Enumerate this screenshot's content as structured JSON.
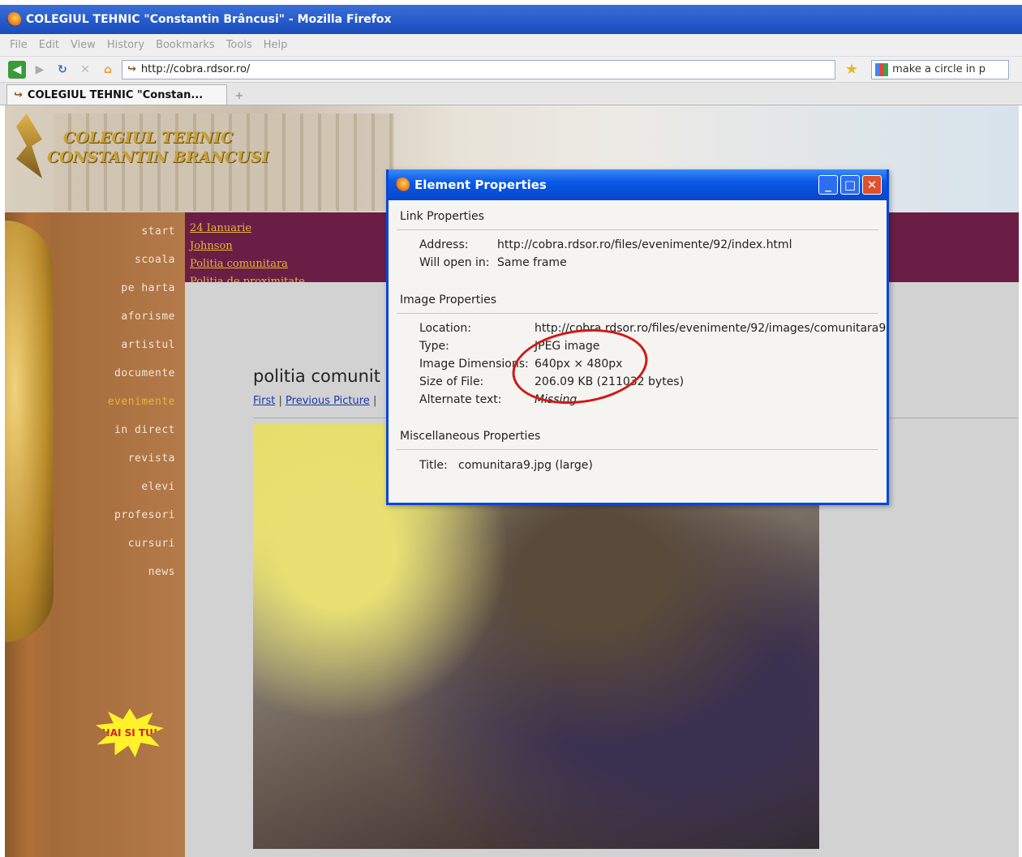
{
  "window": {
    "title": "COLEGIUL TEHNIC \"Constantin Brâncusi\" - Mozilla Firefox"
  },
  "menu": {
    "items": [
      "File",
      "Edit",
      "View",
      "History",
      "Bookmarks",
      "Tools",
      "Help"
    ]
  },
  "navigation": {
    "url": "http://cobra.rdsor.ro/",
    "search_text": "make a circle in p"
  },
  "tabs": {
    "active_label": "COLEGIUL TEHNIC \"Constan...",
    "new_tab_symbol": "+"
  },
  "site": {
    "school_name_line1": "COLEGIUL TEHNIC",
    "school_name_line2": "CONSTANTIN BRANCUSI",
    "sidebar": [
      "start",
      "scoala",
      "pe harta",
      "aforisme",
      "artistul",
      "documente",
      "evenimente",
      "in direct",
      "revista",
      "elevi",
      "profesori",
      "cursuri",
      "news"
    ],
    "sidebar_active_index": 6,
    "badge": "HAI SI TU!",
    "events": [
      "24 Ianuarie",
      "Johnson",
      "Politia comunitara",
      "Politia de proximitate"
    ],
    "heading": "politia comunit",
    "photo_nav": {
      "first": "First",
      "separator": "|",
      "previous": "Previous Picture"
    }
  },
  "dialog": {
    "title": "Element Properties",
    "link_section": "Link Properties",
    "link": {
      "address_label": "Address:",
      "address_value": "http://cobra.rdsor.ro/files/evenimente/92/index.html",
      "open_label": "Will open in:",
      "open_value": "Same frame"
    },
    "image_section": "Image Properties",
    "image": {
      "location_label": "Location:",
      "location_value": "http://cobra.rdsor.ro/files/evenimente/92/images/comunitara9",
      "type_label": "Type:",
      "type_value": "JPEG image",
      "dimensions_label": "Image Dimensions:",
      "dimensions_value": "640px × 480px",
      "size_label": "Size of File:",
      "size_value": "206.09 KB (211032 bytes)",
      "alt_label": "Alternate text:",
      "alt_value": "Missing"
    },
    "misc_section": "Miscellaneous Properties",
    "misc": {
      "title_label": "Title:",
      "title_value": "comunitara9.jpg (large)"
    }
  },
  "colors": {
    "titlebar": "#2357c8",
    "events_strip": "#6b1e45",
    "link_gold": "#e7b43a",
    "annotation_red": "#d01818"
  }
}
